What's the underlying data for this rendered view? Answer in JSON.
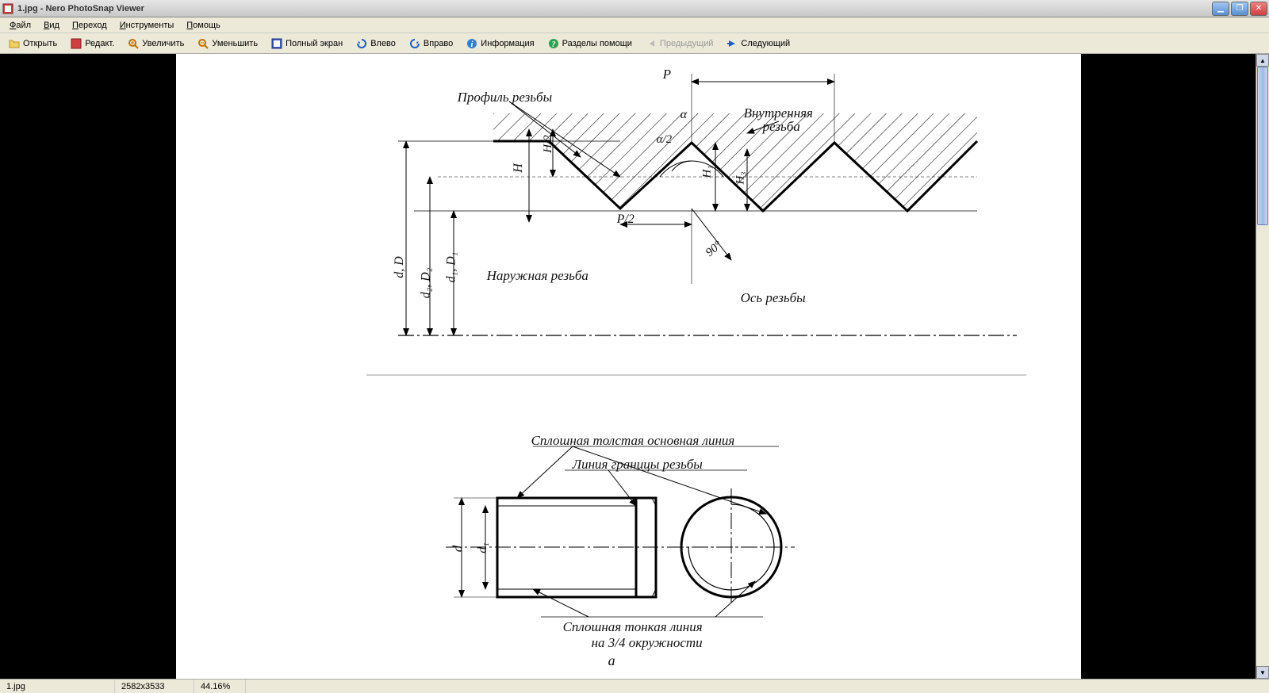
{
  "titlebar": {
    "title": "1.jpg - Nero PhotoSnap Viewer"
  },
  "menubar": {
    "items": [
      {
        "label": "Файл",
        "u": "Ф"
      },
      {
        "label": "Вид",
        "u": "В"
      },
      {
        "label": "Переход",
        "u": "П"
      },
      {
        "label": "Инструменты",
        "u": "И"
      },
      {
        "label": "Помощь",
        "u": "П"
      }
    ]
  },
  "toolbar": {
    "open": "Открыть",
    "edit": "Редакт.",
    "zoomin": "Увеличить",
    "zoomout": "Уменьшить",
    "fullscreen": "Полный экран",
    "left": "Влево",
    "right": "Вправо",
    "info": "Информация",
    "help": "Разделы помощи",
    "prev": "Предыдущий",
    "next": "Следующий"
  },
  "statusbar": {
    "filename": "1.jpg",
    "dimensions": "2582x3533",
    "zoom": "44.16%"
  },
  "diagram": {
    "top": {
      "profile": "Профиль резьбы",
      "internal_line1": "Внутренняя",
      "internal_line2": "резьба",
      "external": "Наружная резьба",
      "axis": "Ось резьбы",
      "P": "P",
      "P2": "P/2",
      "H": "H",
      "H2": "H/2",
      "H1": "H₁",
      "H3": "H₃",
      "alpha": "α",
      "alpha2": "α/2",
      "ninety": "90°",
      "dD": "d, D",
      "d1D1": "d₁, D₁",
      "d2D2": "d₂, D₂"
    },
    "bottom": {
      "thick": "Сплошная толстая основная линия",
      "boundary": "Линия границы резьбы",
      "thin1": "Сплошная тонкая линия",
      "thin2": "на 3/4 окружности",
      "d": "d",
      "d1": "d₁",
      "fig": "а"
    }
  }
}
